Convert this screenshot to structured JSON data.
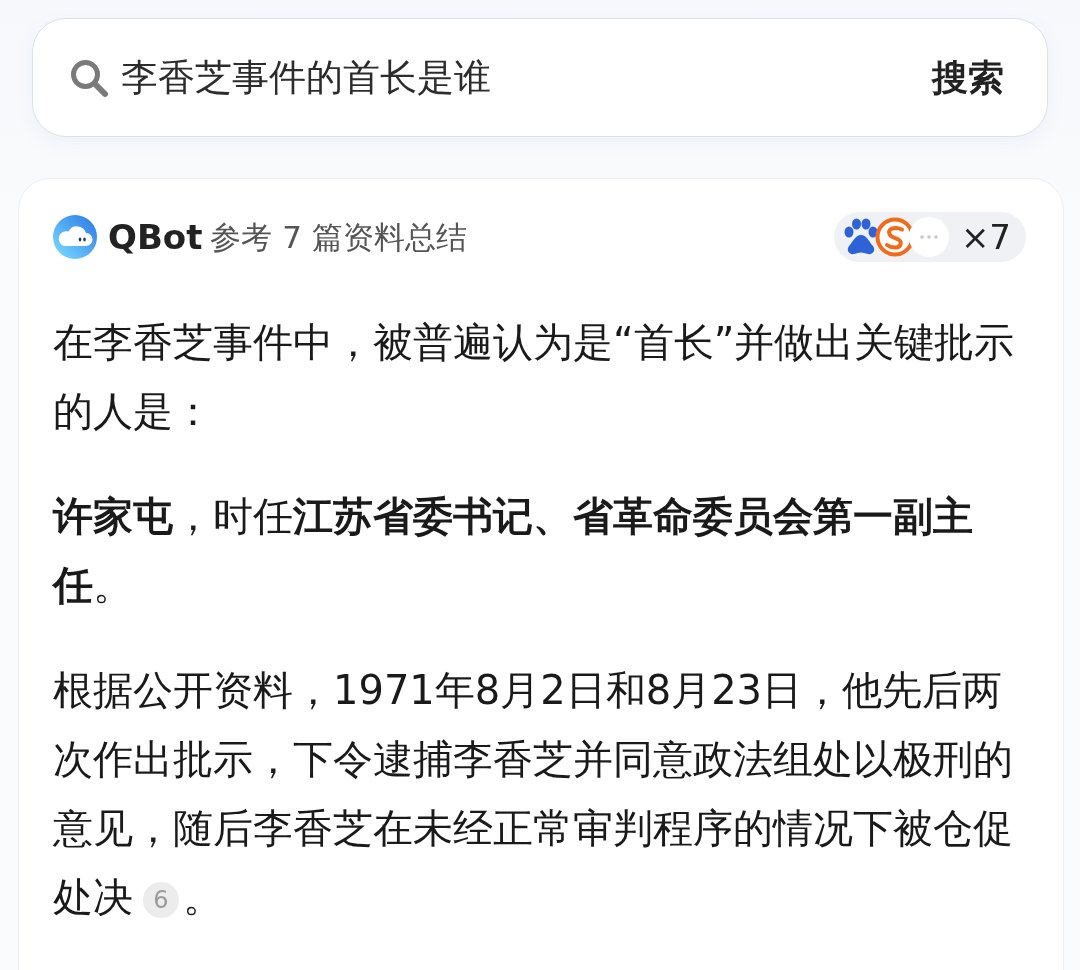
{
  "search": {
    "value": "李香芝事件的首长是谁",
    "button": "搜索"
  },
  "answer": {
    "bot_name": "QBot",
    "summary": "参考 7 篇资料总结",
    "sources_count": "×7",
    "paragraphs": [
      {
        "text": "在李香芝事件中，被普遍认为是“首长”并做出关键批示的人是："
      },
      {
        "text": "**许家屯**，时任**江苏省委书记、省革命委员会第一副主任**。"
      },
      {
        "text": "根据公开资料，1971年8月2日和8月23日，他先后两次作出批示，下令逮捕李香芝并同意政法组处以极刑的意见，随后李香芝在未经正常审判程序的情况下被仓促处决",
        "citation": "6",
        "end": "。"
      }
    ]
  }
}
